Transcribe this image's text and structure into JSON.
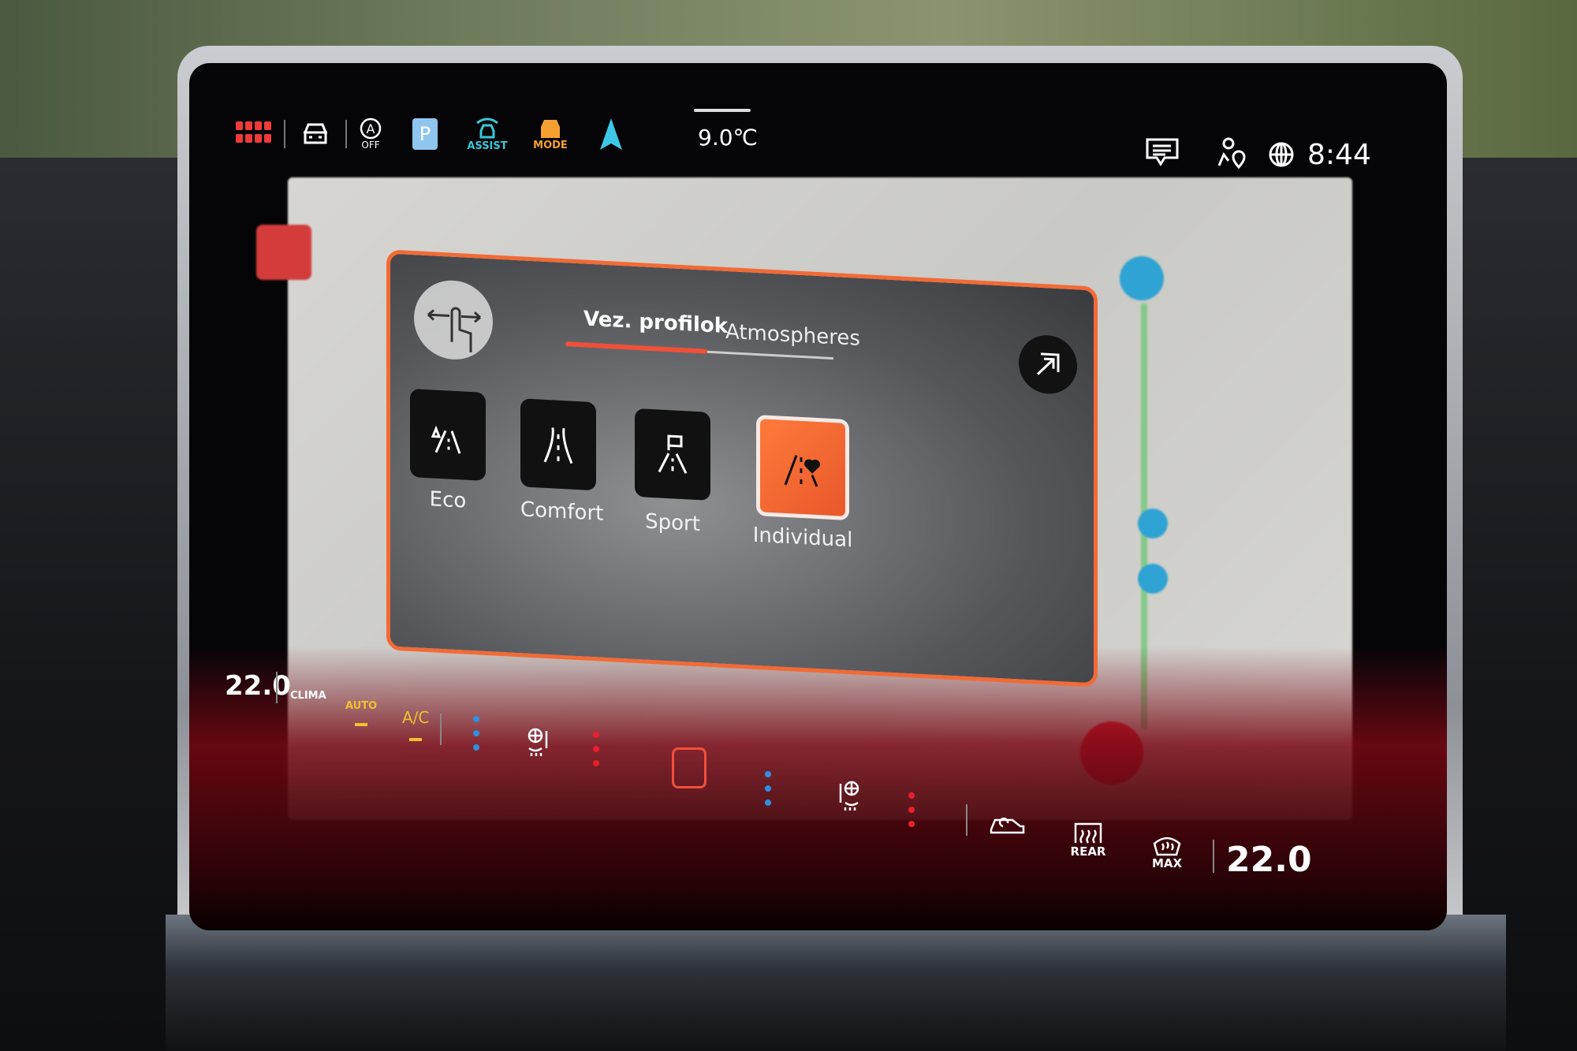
{
  "status_bar": {
    "icons": [
      {
        "name": "apps-grid-icon",
        "color": "#f03a3a"
      },
      {
        "name": "car-icon",
        "color": "#ffffff"
      },
      {
        "name": "auto-hold-off-icon",
        "label": "OFF",
        "color": "#ffffff"
      },
      {
        "name": "parking-icon",
        "label": "P",
        "color": "#8fc6ef"
      },
      {
        "name": "assist-icon",
        "label": "ASSIST",
        "color": "#37c8d8"
      },
      {
        "name": "drive-mode-icon",
        "label": "MODE",
        "color": "#f5a030"
      },
      {
        "name": "navigation-arrow-icon",
        "color": "#3ec7e6"
      }
    ],
    "outside_temp": "9.0℃",
    "right_icons": [
      "message-icon",
      "user-location-icon",
      "globe-icon"
    ],
    "time": "8:44"
  },
  "popup": {
    "tabs": [
      {
        "label": "Vez. profilok",
        "active": true
      },
      {
        "label": "Atmospheres",
        "active": false
      }
    ],
    "profiles": [
      {
        "label": "Eco",
        "icon": "eco-road-icon",
        "active": false
      },
      {
        "label": "Comfort",
        "icon": "comfort-road-icon",
        "active": false
      },
      {
        "label": "Sport",
        "icon": "sport-flag-road-icon",
        "active": false
      },
      {
        "label": "Individual",
        "icon": "individual-heart-road-icon",
        "active": true
      }
    ],
    "accent": "#f26a35"
  },
  "climate": {
    "left_temp": "22.0",
    "clima_label": "CLIMA",
    "auto_label": "AUTO",
    "ac_label": "A/C",
    "rear_label": "REAR",
    "max_label": "MAX",
    "right_temp": "22.0",
    "colors": {
      "cool": "#2f8fe0",
      "heat": "#e8202c",
      "active": "#f2c12e"
    }
  }
}
